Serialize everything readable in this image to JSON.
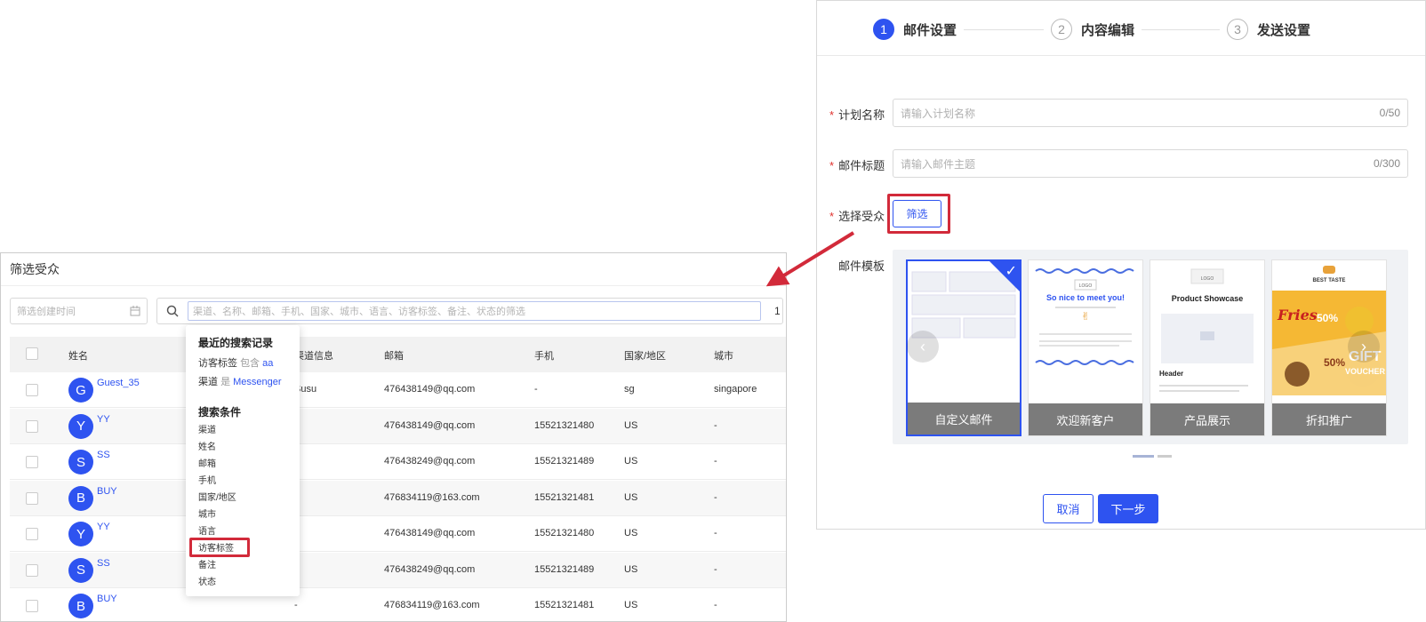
{
  "colors": {
    "primary": "#2e53f0",
    "highlight": "#d22a3a"
  },
  "wizard": {
    "steps": [
      {
        "num": "1",
        "label": "邮件设置"
      },
      {
        "num": "2",
        "label": "内容编辑"
      },
      {
        "num": "3",
        "label": "发送设置"
      }
    ],
    "active_step": 1
  },
  "form": {
    "plan_name": {
      "label": "计划名称",
      "placeholder": "请输入计划名称",
      "counter": "0/50"
    },
    "email_subject": {
      "label": "邮件标题",
      "placeholder": "请输入邮件主题",
      "counter": "0/300"
    },
    "audience": {
      "label": "选择受众",
      "button": "筛选"
    },
    "template": {
      "label": "邮件模板",
      "items": [
        {
          "name": "自定义邮件",
          "selected": true
        },
        {
          "name": "欢迎新客户",
          "heading": "So nice to meet you!",
          "logo_text": "LOGO"
        },
        {
          "name": "产品展示",
          "heading": "Product Showcase",
          "sub_heading": "Header",
          "logo_text": "LOGO"
        },
        {
          "name": "折扣推广",
          "brand": "BEST TASTE",
          "promo1": "Fries",
          "promo2": "GIFT",
          "promo3": "VOUCHER",
          "pct1": "50%",
          "pct2": "50%"
        }
      ]
    },
    "cancel_label": "取消",
    "next_label": "下一步"
  },
  "audience_panel": {
    "title": "筛选受众",
    "date_placeholder": "筛选创建时间",
    "search_placeholder": "渠道、名称、邮箱、手机、国家、城市、语言、访客标签、备注、状态的筛选",
    "search_trail": "1",
    "columns": [
      "姓名",
      "渠道信息",
      "邮箱",
      "手机",
      "国家/地区",
      "城市"
    ],
    "rows": [
      {
        "initial": "G",
        "name": "Guest_35",
        "channel": "Susu",
        "email": "476438149@qq.com",
        "phone": "-",
        "country": "sg",
        "city": "singapore"
      },
      {
        "initial": "Y",
        "name": "YY",
        "channel": "-",
        "email": "476438149@qq.com",
        "phone": "15521321480",
        "country": "US",
        "city": "-"
      },
      {
        "initial": "S",
        "name": "SS",
        "channel": "-",
        "email": "476438249@qq.com",
        "phone": "15521321489",
        "country": "US",
        "city": "-"
      },
      {
        "initial": "B",
        "name": "BUY",
        "channel": "-",
        "email": "476834119@163.com",
        "phone": "15521321481",
        "country": "US",
        "city": "-"
      },
      {
        "initial": "Y",
        "name": "YY",
        "channel": "-",
        "email": "476438149@qq.com",
        "phone": "15521321480",
        "country": "US",
        "city": "-"
      },
      {
        "initial": "S",
        "name": "SS",
        "channel": "-",
        "email": "476438249@qq.com",
        "phone": "15521321489",
        "country": "US",
        "city": "-"
      },
      {
        "initial": "B",
        "name": "BUY",
        "channel": "-",
        "email": "476834119@163.com",
        "phone": "15521321481",
        "country": "US",
        "city": "-"
      }
    ]
  },
  "dropdown": {
    "recent_title": "最近的搜索记录",
    "recent": [
      {
        "field": "访客标签",
        "op": "包含",
        "value": "aa"
      },
      {
        "field": "渠道",
        "op": "是",
        "value": "Messenger"
      }
    ],
    "conditions_title": "搜索条件",
    "conditions": [
      "渠道",
      "姓名",
      "邮箱",
      "手机",
      "国家/地区",
      "城市",
      "语言",
      "访客标签",
      "备注",
      "状态"
    ],
    "highlighted": "访客标签"
  }
}
